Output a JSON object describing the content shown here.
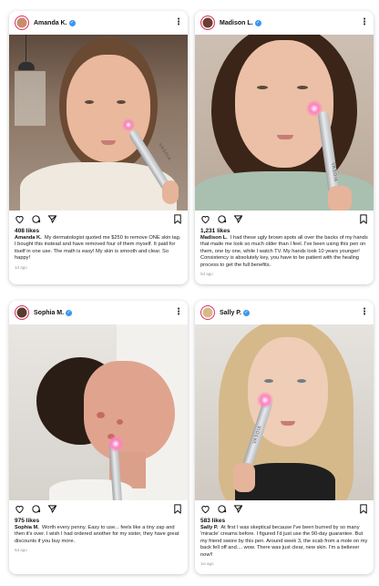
{
  "posts": [
    {
      "username": "Amanda K.",
      "likes": "408 likes",
      "caption": "My dermatologist quoted me $250 to remove ONE skin tag. I bought this instead and have removed four of them myself. It paid for itself in one use. The math is easy! My skin is smooth and clear. So happy!",
      "time": "1d ago",
      "device_label": "VASOIA"
    },
    {
      "username": "Madison L.",
      "likes": "1,231 likes",
      "caption": "I had these ugly brown spots all over the backs of my hands that made me look so much older than I feel. I've been using this pen on them, one by one, while I watch TV. My hands look 10 years younger! Consistency is absolutely key, you have to be patient with the healing process to get the full benefits.",
      "time": "5d ago",
      "device_label": "VASOIA"
    },
    {
      "username": "Sophia M.",
      "likes": "975 likes",
      "caption": "Worth every penny. Easy to use... feels like a tiny zap and then it's over. I wish I had ordered another for my sister, they have great discounts if you buy more.",
      "time": "6d ago",
      "device_label": ""
    },
    {
      "username": "Sally P.",
      "likes": "583 likes",
      "caption": "At first I was skeptical because I've been burned by so many 'miracle' creams before. I figured I'd just use the 90-day guarantee. But my friend swore by this pen. Around week 3, the scab from a mole on my back fell off and.... wow. There was just clear, new skin. I'm a believer now!!",
      "time": "1w ago",
      "device_label": "VASOIA"
    }
  ],
  "icons": {
    "like": "heart-icon",
    "comment": "comment-icon",
    "share": "send-icon",
    "save": "bookmark-icon",
    "more": "more-options-icon",
    "verified": "verified-badge-icon"
  },
  "colors": {
    "verified": "#3897f0",
    "avatar_ring": "#e1306c",
    "glow": "#ff5fb0"
  }
}
